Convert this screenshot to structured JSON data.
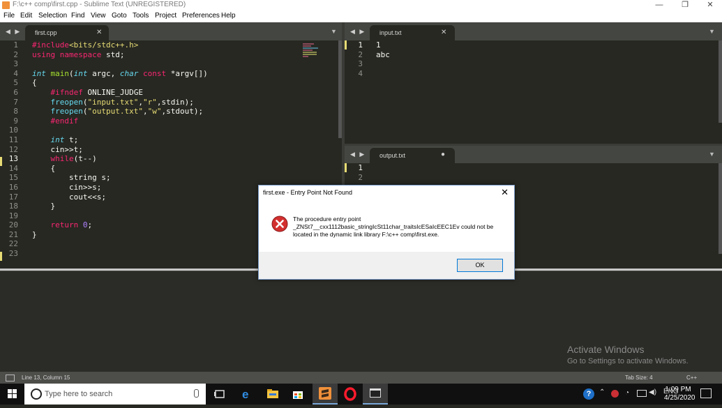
{
  "window": {
    "title": "F:\\c++ comp\\first.cpp - Sublime Text (UNREGISTERED)",
    "minimize": "—",
    "maximize": "❐",
    "close": "✕"
  },
  "menu": [
    "File",
    "Edit",
    "Selection",
    "Find",
    "View",
    "Goto",
    "Tools",
    "Project",
    "Preferences",
    "Help"
  ],
  "left_pane": {
    "nav_arrows": "◀ ▶",
    "tab_title": "first.cpp",
    "tab_close": "✕",
    "dropdown": "▼",
    "line_numbers": [
      "1",
      "2",
      "3",
      "4",
      "5",
      "6",
      "7",
      "8",
      "9",
      "10",
      "11",
      "12",
      "13",
      "14",
      "15",
      "16",
      "17",
      "18",
      "19",
      "20",
      "21",
      "22",
      "23"
    ]
  },
  "right_top_pane": {
    "nav_arrows": "◀ ▶",
    "tab_title": "input.txt",
    "tab_close": "✕",
    "dropdown": "▼",
    "line_numbers": [
      "1",
      "2",
      "3",
      "4"
    ],
    "lines": [
      "1",
      "abc",
      "",
      ""
    ]
  },
  "right_bottom_pane": {
    "nav_arrows": "◀ ▶",
    "tab_title": "output.txt",
    "tab_dirty": "●",
    "dropdown": "▼",
    "line_numbers": [
      "1",
      "2"
    ]
  },
  "dialog": {
    "title": "first.exe - Entry Point Not Found",
    "close": "✕",
    "icon": "error-icon",
    "message_line1": "The procedure entry point",
    "message_line2": "_ZNSt7__cxx1112basic_stringIcSt11char_traitsIcESaIcEEC1Ev could not be",
    "message_line3": "located in the dynamic link library F:\\c++ comp\\first.exe.",
    "ok": "OK"
  },
  "watermark": {
    "line1": "Activate Windows",
    "line2": "Go to Settings to activate Windows."
  },
  "status": {
    "position": "Line 13, Column 15",
    "tab_size": "Tab Size: 4",
    "syntax": "C++"
  },
  "taskbar": {
    "search_placeholder": "Type here to search",
    "time": "1:09 PM",
    "date": "4/25/2020"
  },
  "colors": {
    "editor_bg": "#272822",
    "keyword": "#f92672",
    "string": "#e6db74",
    "type": "#66d9ef",
    "number": "#ae81ff",
    "error": "#d32f2f"
  }
}
